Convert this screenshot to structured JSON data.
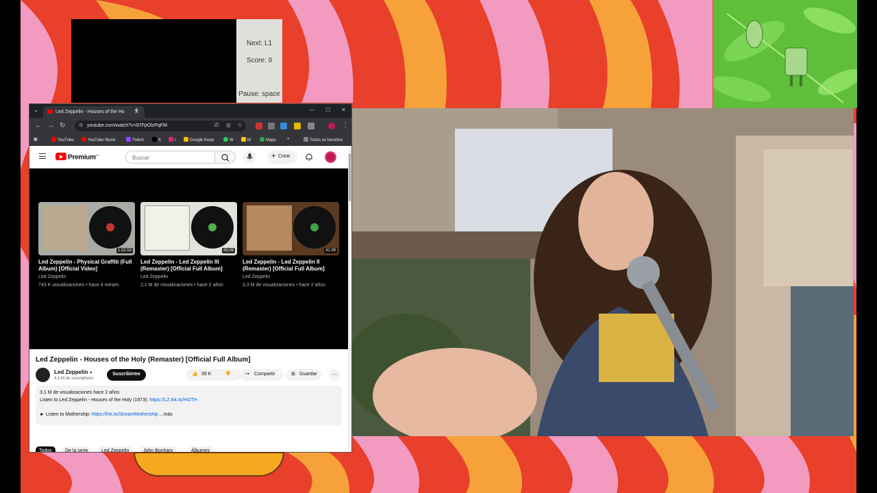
{
  "game": {
    "next_label": "Next: L1",
    "score_label": "Score: 9",
    "pause_label": "Pause: space"
  },
  "browser": {
    "tab_title": "Led Zeppelin - Houses of the Ho",
    "url": "youtube.com/watch?v=97FpOlzPqFM",
    "bookmarks": [
      "YouTube",
      "YouTube Music",
      "Twitch",
      "X",
      "I",
      "Google Keep",
      "W",
      "M",
      "Maps",
      "Todos os favoritos"
    ]
  },
  "youtube": {
    "brand": "Premium",
    "brand_region": "AR",
    "search_placeholder": "Buscar",
    "create_label": "Crear",
    "end_cards": [
      {
        "title": "Led Zeppelin - Physical Graffiti (Full Album) [Official Video]",
        "channel": "Led Zeppelin",
        "meta": "743 K visualizaciones • hace 4 meses",
        "duration": "1:22:53"
      },
      {
        "title": "Led Zeppelin - Led Zeppelin III (Remaster) [Official Full Album]",
        "channel": "Led Zeppelin",
        "meta": "2,1 M de visualizaciones • hace 2 años",
        "duration": "43:08"
      },
      {
        "title": "Led Zeppelin - Led Zeppelin II (Remaster) [Official Full Album]",
        "channel": "Led Zeppelin",
        "meta": "3,3 M de visualizaciones • hace 2 años",
        "duration": "41:39"
      }
    ],
    "video_title": "Led Zeppelin - Houses of the Holy (Remaster) [Official Full Album]",
    "channel_name": "Led Zeppelin",
    "subscribers": "4,3 M de suscriptores",
    "subscribe_label": "Suscribirme",
    "like_count": "39 K",
    "share_label": "Compartir",
    "save_label": "Guardar",
    "description": {
      "stats": "3,1 M de visualizaciones  hace 2 años",
      "line1": "Listen to Led Zeppelin - Houses of the Holy (1973):",
      "link1": "https://LZ.lnk.to/HOTH",
      "line2": "► Listen to Mothership:",
      "link2": "https://lnk.to/StreamMothership",
      "more": "...más"
    },
    "chips": [
      "Todos",
      "De la serie",
      "Led Zeppelin",
      "John Bonham",
      "Álbumes"
    ]
  }
}
